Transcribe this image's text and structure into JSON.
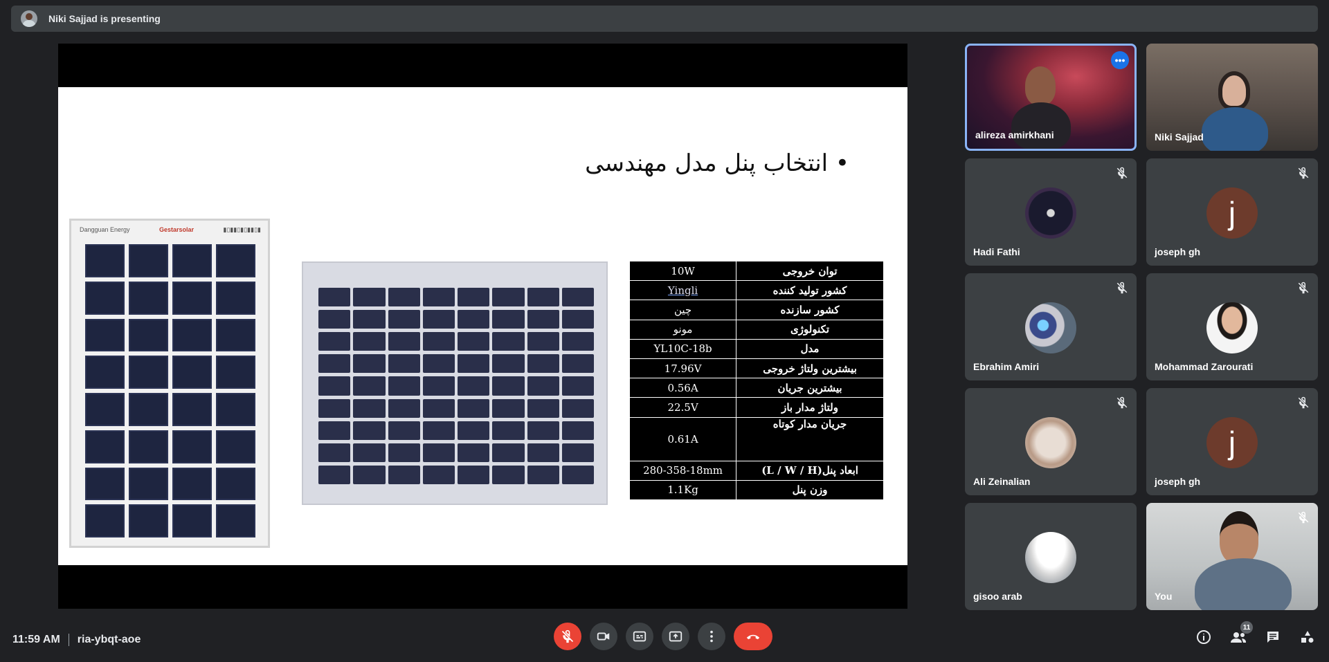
{
  "presenting_bar": {
    "text": "Niki Sajjad is presenting"
  },
  "slide": {
    "title": "• انتخاب پنل مدل مهندسی",
    "panel1_labels": {
      "left": "Dangguan Energy",
      "brand": "Gestarsolar"
    },
    "spec_rows": [
      {
        "key": "توان خروجی",
        "value": "10W"
      },
      {
        "key": "کشور تولید کننده",
        "value": "Yingli"
      },
      {
        "key": "کشور سازنده",
        "value": "چین"
      },
      {
        "key": "تکنولوژی",
        "value": "مونو"
      },
      {
        "key": "مدل",
        "value": "YL10C-18b"
      },
      {
        "key": "بیشترین ولتاژ خروجی",
        "value": "17.96V"
      },
      {
        "key": "بیشترین جریان",
        "value": "0.56A"
      },
      {
        "key": "ولتاژ مدار باز",
        "value": "22.5V"
      },
      {
        "key": "جریان مدار کوتاه",
        "value": "0.61A"
      },
      {
        "key": "ابعاد پنل(L / W / H)",
        "value": "280-358-18mm"
      },
      {
        "key": "وزن پنل",
        "value": "1.1Kg"
      }
    ]
  },
  "participants": [
    {
      "name": "alireza amirkhani",
      "type": "video",
      "muted": false,
      "active": true
    },
    {
      "name": "Niki Sajjad",
      "type": "video",
      "muted": false
    },
    {
      "name": "Hadi Fathi",
      "type": "avatar",
      "muted": true
    },
    {
      "name": "joseph gh",
      "type": "letter",
      "letter": "j",
      "muted": true
    },
    {
      "name": "Ebrahim Amiri",
      "type": "avatar",
      "muted": true
    },
    {
      "name": "Mohammad Zarourati",
      "type": "avatar",
      "muted": true
    },
    {
      "name": "Ali Zeinalian",
      "type": "avatar",
      "muted": true
    },
    {
      "name": "joseph gh",
      "type": "letter",
      "letter": "j",
      "muted": true
    },
    {
      "name": "gisoo arab",
      "type": "avatar",
      "muted": false
    },
    {
      "name": "You",
      "type": "video",
      "muted": true
    }
  ],
  "bottom_bar": {
    "time": "11:59 AM",
    "meeting_code": "ria-ybqt-aoe",
    "participant_count": "11"
  },
  "colors": {
    "accent": "#8ab4f8",
    "danger": "#ea4335",
    "bg": "#202124",
    "tile": "#3c4043"
  }
}
